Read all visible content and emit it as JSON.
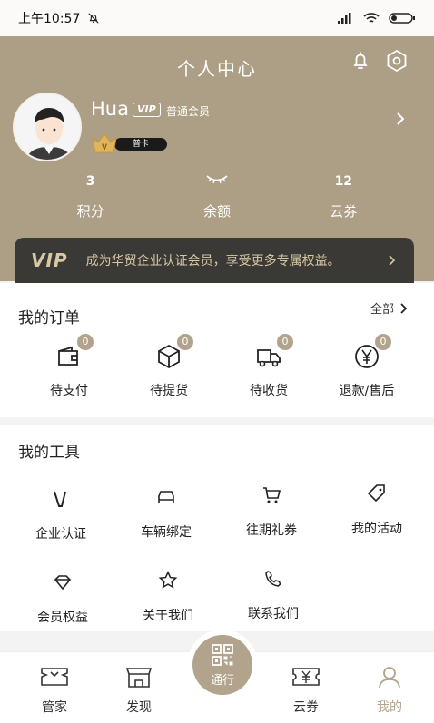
{
  "status": {
    "time": "上午10:57"
  },
  "header": {
    "title": "个人中心",
    "username": "Hua",
    "vip_tag": "VIP",
    "member_level": "普通会员",
    "card_label": "普卡"
  },
  "stats": [
    {
      "value": "3",
      "label": "积分"
    },
    {
      "value": "",
      "label": "余额"
    },
    {
      "value": "12",
      "label": "云券"
    }
  ],
  "vip_banner": {
    "logo": "VIP",
    "text": "成为华贸企业认证会员，享受更多专属权益。"
  },
  "orders": {
    "title": "我的订单",
    "all_label": "全部",
    "items": [
      {
        "label": "待支付",
        "count": "0",
        "icon": "wallet-icon"
      },
      {
        "label": "待提货",
        "count": "0",
        "icon": "package-icon"
      },
      {
        "label": "待收货",
        "count": "0",
        "icon": "truck-icon"
      },
      {
        "label": "退款/售后",
        "count": "0",
        "icon": "yen-refund-icon"
      }
    ]
  },
  "tools": {
    "title": "我的工具",
    "items": [
      {
        "label": "企业认证",
        "icon": "v-icon"
      },
      {
        "label": "车辆绑定",
        "icon": "car-icon"
      },
      {
        "label": "往期礼券",
        "icon": "cart-icon"
      },
      {
        "label": "我的活动",
        "icon": "tag-icon"
      },
      {
        "label": "会员权益",
        "icon": "diamond-icon"
      },
      {
        "label": "关于我们",
        "icon": "star-icon"
      },
      {
        "label": "联系我们",
        "icon": "phone-icon"
      }
    ]
  },
  "nav": {
    "items": [
      {
        "label": "管家",
        "icon": "butler-icon"
      },
      {
        "label": "发现",
        "icon": "store-icon"
      },
      {
        "label": "通行",
        "icon": "qrcode-icon"
      },
      {
        "label": "云券",
        "icon": "coupon-icon"
      },
      {
        "label": "我的",
        "icon": "person-icon"
      }
    ],
    "active": "我的"
  },
  "colors": {
    "accent": "#b2a48c",
    "header": "#ad9f86",
    "banner": "#3b3935"
  }
}
